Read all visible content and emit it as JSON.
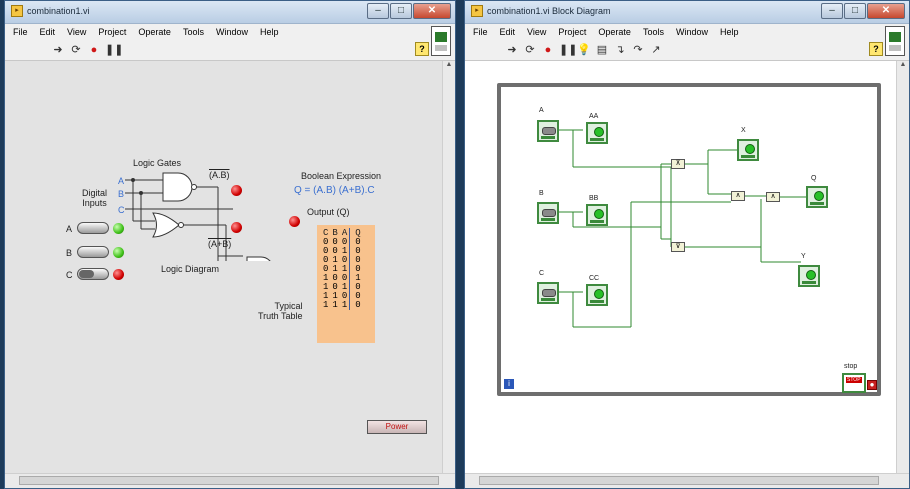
{
  "left_window": {
    "title": "combination1.vi",
    "menu": [
      "File",
      "Edit",
      "View",
      "Project",
      "Operate",
      "Tools",
      "Window",
      "Help"
    ],
    "panel": {
      "logic_gates_label": "Logic Gates",
      "digital_inputs_label": "Digital\nInputs",
      "input_letters": [
        "A",
        "B",
        "C"
      ],
      "nand_expr": "(A.B)",
      "nor_expr": "(A+B)",
      "boolean_expression_label": "Boolean Expression",
      "boolean_expression": "Q = (A.B) (A+B).C",
      "output_label": "Output (Q)",
      "logic_diagram_label": "Logic Diagram",
      "switch_labels": [
        "A",
        "B",
        "C"
      ],
      "truth_table_label": "Typical\nTruth Table",
      "truth_table": {
        "headers": [
          "C",
          "B",
          "A",
          "Q"
        ],
        "rows": [
          [
            "0",
            "0",
            "0",
            "0"
          ],
          [
            "0",
            "0",
            "1",
            "0"
          ],
          [
            "0",
            "1",
            "0",
            "0"
          ],
          [
            "0",
            "1",
            "1",
            "0"
          ],
          [
            "1",
            "0",
            "0",
            "1"
          ],
          [
            "1",
            "0",
            "1",
            "0"
          ],
          [
            "1",
            "1",
            "0",
            "0"
          ],
          [
            "1",
            "1",
            "1",
            "0"
          ]
        ]
      },
      "power_button": "Power"
    }
  },
  "right_window": {
    "title": "combination1.vi Block Diagram",
    "menu": [
      "File",
      "Edit",
      "View",
      "Project",
      "Operate",
      "Tools",
      "Window",
      "Help"
    ],
    "terminals": {
      "control_labels": [
        "A",
        "B",
        "C"
      ],
      "indicator_labels": [
        "AA",
        "BB",
        "CC"
      ],
      "output_labels": [
        "X",
        "Q",
        "Y"
      ],
      "stop_label": "stop",
      "loop_iteration": "i"
    }
  }
}
